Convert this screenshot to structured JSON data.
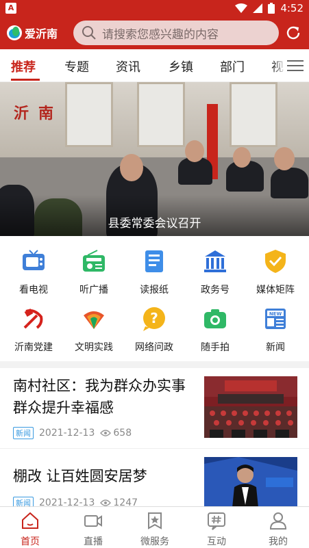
{
  "status_bar": {
    "time": "4:52",
    "left_badge": "A"
  },
  "header": {
    "app_name": "爱沂南",
    "search_placeholder": "请搜索您感兴趣的内容"
  },
  "tabs": [
    {
      "label": "推荐",
      "active": true
    },
    {
      "label": "专题"
    },
    {
      "label": "资讯"
    },
    {
      "label": "乡镇"
    },
    {
      "label": "部门"
    },
    {
      "label": "视"
    }
  ],
  "banner": {
    "caption": "县委常委会议召开",
    "sign_text": "沂南"
  },
  "grid": [
    {
      "label": "看电视",
      "icon": "tv-icon"
    },
    {
      "label": "听广播",
      "icon": "radio-icon"
    },
    {
      "label": "读报纸",
      "icon": "newspaper-icon"
    },
    {
      "label": "政务号",
      "icon": "government-building-icon"
    },
    {
      "label": "媒体矩阵",
      "icon": "shield-check-icon"
    },
    {
      "label": "沂南党建",
      "icon": "party-emblem-icon"
    },
    {
      "label": "文明实践",
      "icon": "peacock-icon"
    },
    {
      "label": "网络问政",
      "icon": "question-icon"
    },
    {
      "label": "随手拍",
      "icon": "camera-icon"
    },
    {
      "label": "新闻",
      "icon": "news-icon"
    }
  ],
  "news": [
    {
      "title": "南村社区：我为群众办实事 群众提升幸福感",
      "badge": "新闻",
      "date": "2021-12-13",
      "views": "658"
    },
    {
      "title": "棚改 让百姓圆安居梦",
      "badge": "新闻",
      "date": "2021-12-13",
      "views": "1247"
    }
  ],
  "bottom_nav": [
    {
      "label": "首页",
      "icon": "home-icon",
      "active": true
    },
    {
      "label": "直播",
      "icon": "video-camera-icon"
    },
    {
      "label": "微服务",
      "icon": "star-badge-icon"
    },
    {
      "label": "互动",
      "icon": "hashtag-icon"
    },
    {
      "label": "我的",
      "icon": "user-icon"
    }
  ],
  "colors": {
    "brand_red": "#c8251c",
    "badge_blue": "#3a9ae0"
  }
}
